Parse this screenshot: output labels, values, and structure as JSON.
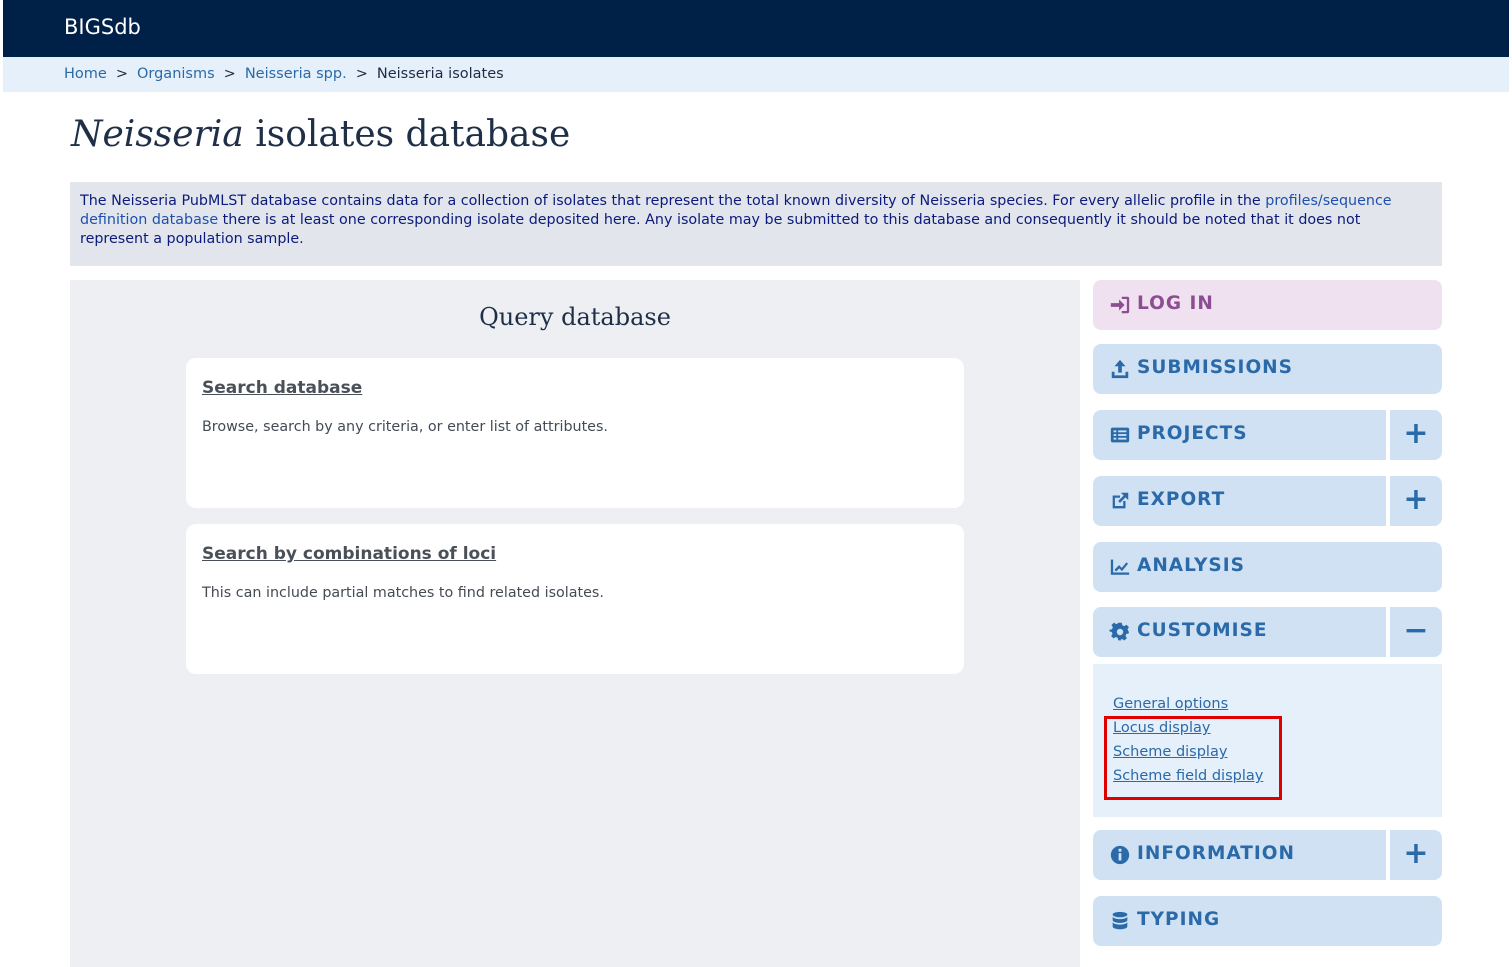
{
  "header": {
    "brand": "BIGSdb"
  },
  "breadcrumb": {
    "items": [
      "Home",
      "Organisms",
      "Neisseria spp."
    ],
    "current": "Neisseria isolates",
    "separator": ">"
  },
  "page": {
    "title_italic": "Neisseria",
    "title_rest": " isolates database"
  },
  "description": {
    "text_before_link": "The Neisseria PubMLST database contains data for a collection of isolates that represent the total known diversity of Neisseria species. For every allelic profile in the ",
    "link": "profiles/sequence definition database",
    "text_after_link": " there is at least one corresponding isolate deposited here. Any isolate may be submitted to this database and consequently it should be noted that it does not represent a population sample."
  },
  "query": {
    "title": "Query database",
    "cards": [
      {
        "link": "Search database",
        "text": "Browse, search by any criteria, or enter list of attributes."
      },
      {
        "link": "Search by combinations of loci",
        "text": "This can include partial matches to find related isolates."
      }
    ]
  },
  "menu": {
    "login": "LOG IN",
    "submissions": "SUBMISSIONS",
    "projects": "PROJECTS",
    "export": "EXPORT",
    "analysis": "ANALYSIS",
    "customise": "CUSTOMISE",
    "information": "INFORMATION",
    "typing": "TYPING",
    "plus": "+",
    "minus": "−",
    "customise_items": [
      "General options",
      "Locus display",
      "Scheme display",
      "Scheme field display"
    ]
  },
  "colors": {
    "topbar": "#002147",
    "menu_bg": "#cfe1f3",
    "menu_text": "#2b6aa8",
    "login_bg": "#efe1ef",
    "login_text": "#8d4d93",
    "highlight": "#e00000"
  }
}
